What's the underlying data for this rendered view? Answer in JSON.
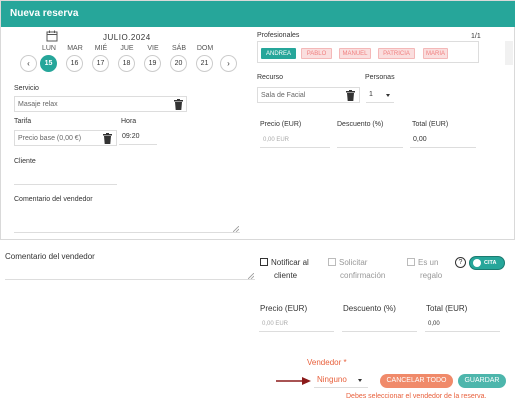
{
  "modal": {
    "title": "Nueva reserva"
  },
  "calendar": {
    "month": "JULIO.2024",
    "days": [
      {
        "name": "LUN",
        "num": "15",
        "selected": true
      },
      {
        "name": "MAR",
        "num": "16"
      },
      {
        "name": "MIÉ",
        "num": "17"
      },
      {
        "name": "JUE",
        "num": "18"
      },
      {
        "name": "VIE",
        "num": "19"
      },
      {
        "name": "SÁB",
        "num": "20"
      },
      {
        "name": "DOM",
        "num": "21"
      }
    ],
    "prev_icon": "chevron-left-icon",
    "next_icon": "chevron-right-icon"
  },
  "form": {
    "servicio_label": "Servicio",
    "servicio_value": "Masaje relax",
    "tarifa_label": "Tarifa",
    "tarifa_value": "Precio base (0,00 €)",
    "hora_label": "Hora",
    "hora_value": "09:20",
    "cliente_label": "Cliente",
    "comentario_label": "Comentario del vendedor"
  },
  "professionals": {
    "label": "Profesionales",
    "pager": "1/1",
    "items": [
      "ANDREA",
      "PABLO",
      "MANUEL",
      "PATRICIA",
      "MARIA"
    ],
    "active": "ANDREA"
  },
  "resource": {
    "recurso_label": "Recurso",
    "recurso_value": "Sala de Facial",
    "personas_label": "Personas",
    "personas_value": "1"
  },
  "inner_totals": {
    "precio_label": "Precio (EUR)",
    "precio_value": "0,00 EUR",
    "descuento_label": "Descuento (%)",
    "total_label": "Total (EUR)",
    "total_value": "0,00"
  },
  "outer": {
    "comentario_label": "Comentario del vendedor",
    "notificar_label": "Notificar al cliente",
    "notificar_line1": "Notificar al",
    "notificar_line2": "cliente",
    "solicitar_line1": "Solicitar",
    "solicitar_line2": "confirmación",
    "regalo_line1": "Es un",
    "regalo_line2": "regalo",
    "help_icon": "?",
    "cita_label": "CITA"
  },
  "outer_totals": {
    "precio_label": "Precio (EUR)",
    "precio_value": "0,00 EUR",
    "descuento_label": "Descuento (%)",
    "total_label": "Total (EUR)",
    "total_value": "0,00"
  },
  "footer": {
    "vendedor_label": "Vendedor *",
    "vendedor_value": "Ninguno",
    "cancel_label": "CANCELAR TODO",
    "save_label": "GUARDAR",
    "error": "Debes seleccionar el vendedor de la reserva."
  },
  "colors": {
    "accent": "#26a69a",
    "error": "#e8603c",
    "chip_bg": "#fadede",
    "cancel_bg": "#f08a6a",
    "save_bg": "#4db6ac"
  }
}
